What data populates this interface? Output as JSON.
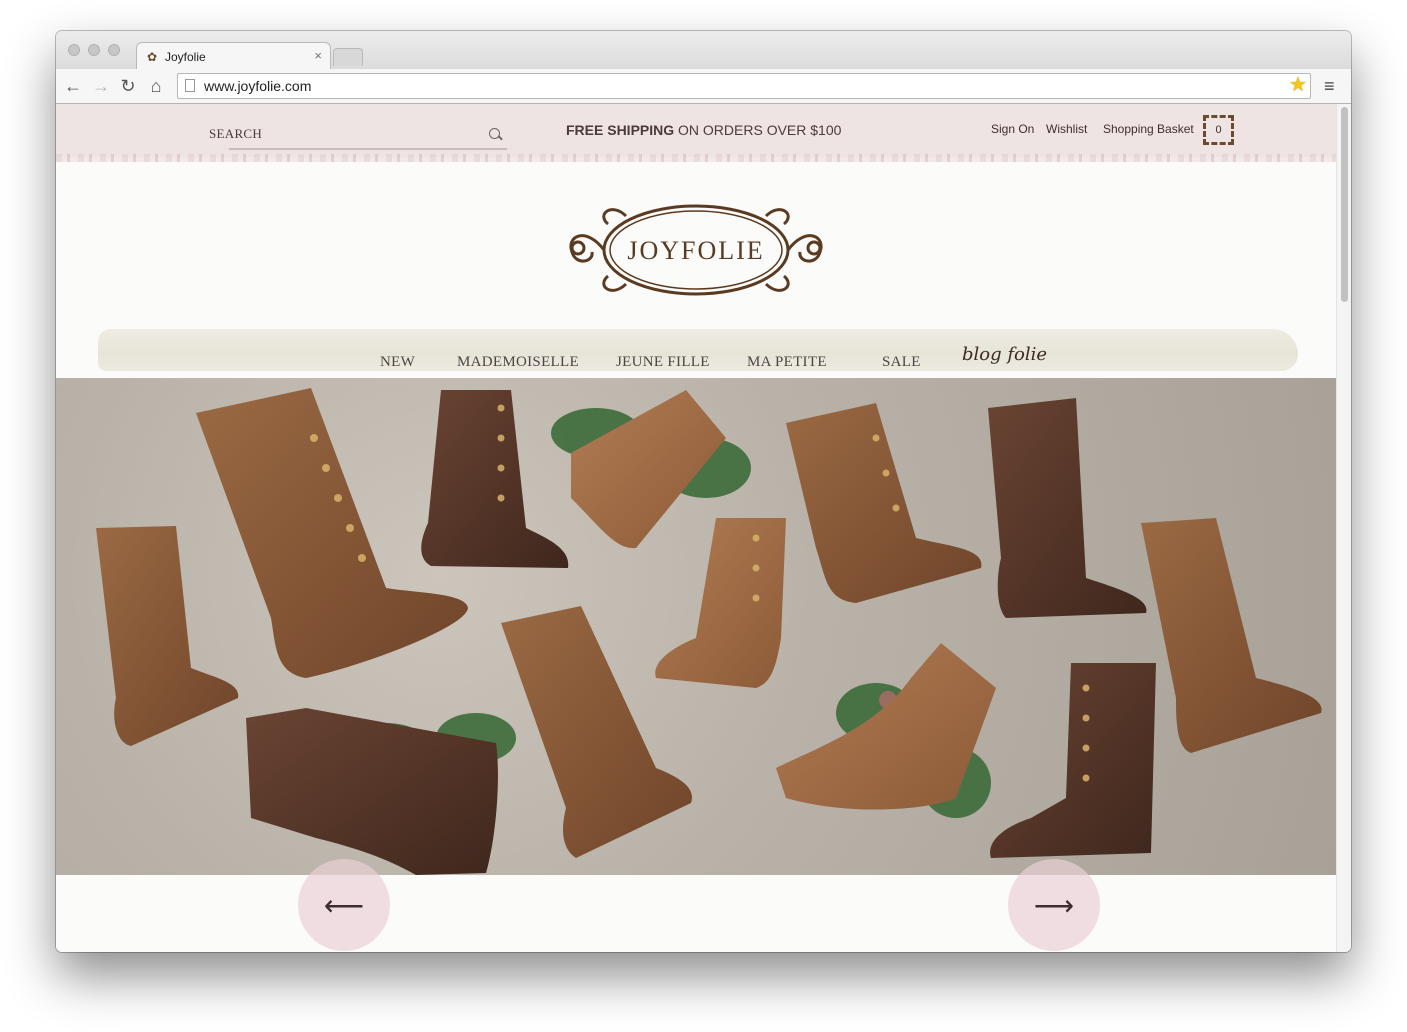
{
  "browser": {
    "tab_title": "Joyfolie",
    "tab_close": "×",
    "url": "www.joyfolie.com",
    "back_icon": "←",
    "forward_icon": "→",
    "reload_icon": "↻",
    "home_icon": "⌂",
    "star_icon": "★",
    "menu_icon": "≡"
  },
  "topbar": {
    "search_label": "SEARCH",
    "shipping_bold": "FREE SHIPPING",
    "shipping_rest": " ON ORDERS OVER $100",
    "sign_on": "Sign On",
    "wishlist": "Wishlist",
    "basket_label": "Shopping Basket",
    "basket_count": "0"
  },
  "logo": {
    "text": "JOYFOLIE"
  },
  "nav": {
    "items": [
      "NEW",
      "MADEMOISELLE",
      "JEUNE FILLE",
      "MA PETITE",
      "SALE"
    ],
    "blog": "blog folie"
  },
  "carousel": {
    "prev_icon": "⟵",
    "next_icon": "⟶"
  },
  "colors": {
    "topbar_bg": "#efe4e4",
    "logo_brown": "#5b3a22",
    "accent_pink": "#ead0d6"
  }
}
